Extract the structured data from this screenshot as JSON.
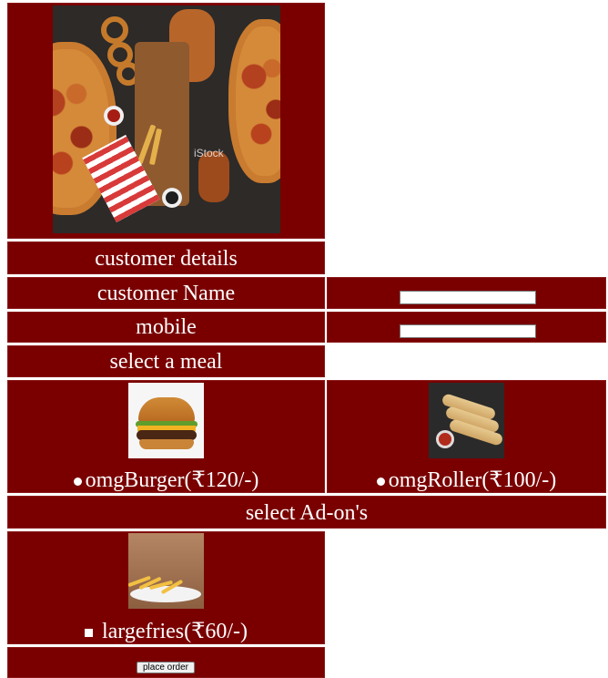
{
  "hero": {
    "watermark": "iStock",
    "icon": "food-spread-image"
  },
  "customer_details": {
    "heading": "customer details"
  },
  "fields": {
    "name_label": "customer Name",
    "name_value": "",
    "mobile_label": "mobile",
    "mobile_value": ""
  },
  "meal": {
    "heading": "select a meal",
    "options": [
      {
        "label": "omgBurger(₹120/-)",
        "icon": "burger-image",
        "selected": false
      },
      {
        "label": "omgRoller(₹100/-)",
        "icon": "roller-image",
        "selected": false
      }
    ]
  },
  "addons": {
    "heading": "select Ad-on's",
    "options": [
      {
        "label": "largefries(₹60/-)",
        "icon": "fries-image",
        "checked": false
      }
    ]
  },
  "actions": {
    "submit_label": "place order"
  },
  "colors": {
    "panel": "#7a0000",
    "text": "#ffffff"
  }
}
